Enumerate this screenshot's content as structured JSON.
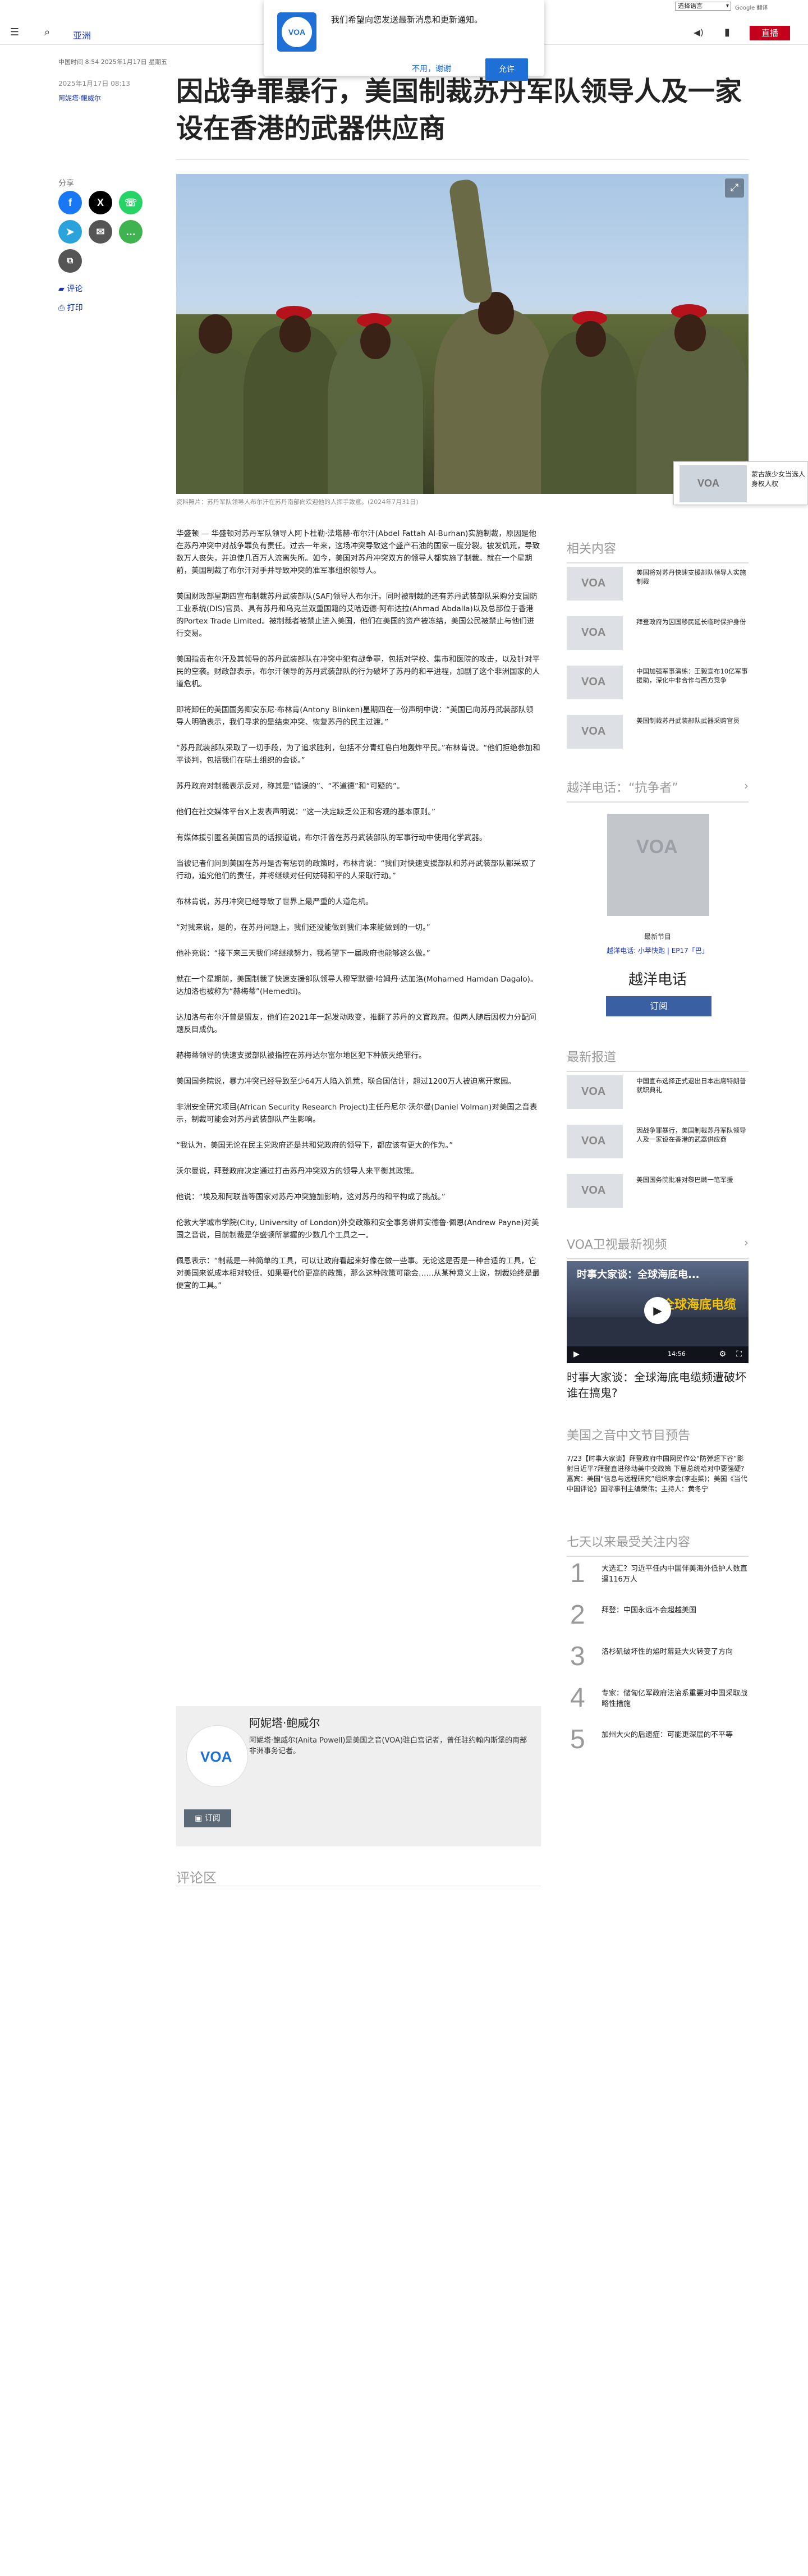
{
  "util": {
    "language": "选择语言",
    "powered": "Google 翻译"
  },
  "header": {
    "section": "亚洲",
    "live": "直播"
  },
  "popup": {
    "logo": "VOA",
    "message": "我们希望向您发送最新消息和更新通知。",
    "deny": "不用，谢谢",
    "allow": "允许"
  },
  "article": {
    "meta": "中国时间 8:54 2025年1月17日 星期五",
    "pubdate": "2025年1月17日 08:13",
    "author": "阿妮塔·鲍威尔",
    "title": "因战争罪暴行，美国制裁苏丹军队领导人及一家设在香港的武器供应商",
    "caption": "资料照片：苏丹军队领导人布尔汗在苏丹南部向欢迎他的人挥手致意。(2024年7月31日)",
    "paragraphs": [
      "华盛顿 — 华盛顿对苏丹军队领导人阿卜杜勒·法塔赫·布尔汗(Abdel Fattah Al-Burhan)实施制裁，原因是他在苏丹冲突中对战争罪负有责任。过去一年来，这场冲突导致这个盛产石油的国家一度分裂。被发饥荒，导致数万人丧失，并迫使几百万人流离失所。如今，美国对苏丹冲突双方的领导人都实施了制裁。就在一个星期前，美国制裁了布尔汗对手并导致冲突的准军事组织领导人。",
      "美国财政部星期四宣布制裁苏丹武装部队(SAF)领导人布尔汗。同时被制裁的还有苏丹武装部队采购分支国防工业系统(DIS)官员、具有苏丹和乌克兰双重国籍的艾哈迈德·阿布达拉(Ahmad Abdalla)以及总部位于香港的Portex Trade Limited。被制裁者被禁止进入美国，他们在美国的资产被冻结，美国公民被禁止与他们进行交易。",
      "美国指责布尔汗及其领导的苏丹武装部队在冲突中犯有战争罪，包括对学校、集市和医院的攻击，以及针对平民的空袭。财政部表示，布尔汗领导的苏丹武装部队的行为破坏了苏丹的和平进程，加剧了这个非洲国家的人道危机。",
      "即将卸任的美国国务卿安东尼·布林肯(Antony Blinken)星期四在一份声明中说：“美国已向苏丹武装部队领导人明确表示，我们寻求的是结束冲突、恢复苏丹的民主过渡。”",
      "“苏丹武装部队采取了一切手段，为了追求胜利，包括不分青红皂白地轰炸平民。”布林肯说。“他们拒绝参加和平谈判，包括我们在瑞士组织的会谈。”",
      "苏丹政府对制裁表示反对，称其是“错误的”、“不道德”和“可疑的”。",
      "他们在社交媒体平台X上发表声明说：“这一决定缺乏公正和客观的基本原则。”",
      "有媒体援引匿名美国官员的话报道说，布尔汗曾在苏丹武装部队的军事行动中使用化学武器。",
      "当被记者们问到美国在苏丹是否有惩罚的政策时，布林肯说：“我们对快速支援部队和苏丹武装部队都采取了行动，追究他们的责任，并将继续对任何妨碍和平的人采取行动。”",
      "布林肯说，苏丹冲突已经导致了世界上最严重的人道危机。",
      "“对我来说，是的，在苏丹问题上，我们还没能做到我们本来能做到的一切。”",
      "他补充说：“接下来三天我们将继续努力，我希望下一届政府也能够这么做。”",
      "就在一个星期前，美国制裁了快速支援部队领导人穆罕默德·哈姆丹·达加洛(Mohamed Hamdan Dagalo)。达加洛也被称为“赫梅蒂”(Hemedti)。",
      "达加洛与布尔汗曾是盟友，他们在2021年一起发动政变，推翻了苏丹的文官政府。但两人随后因权力分配问题反目成仇。",
      "赫梅蒂领导的快速支援部队被指控在苏丹达尔富尔地区犯下种族灭绝罪行。",
      "美国国务院说，暴力冲突已经导致至少64万人陷入饥荒，联合国估计，超过1200万人被迫离开家园。",
      "非洲安全研究项目(African Security Research Project)主任丹尼尔·沃尔曼(Daniel Volman)对美国之音表示，制裁可能会对苏丹武装部队产生影响。",
      "“我认为，美国无论在民主党政府还是共和党政府的领导下，都应该有更大的作为。”",
      "沃尔曼说，拜登政府决定通过打击苏丹冲突双方的领导人来平衡其政策。",
      "他说：“埃及和阿联酋等国家对苏丹冲突施加影响，这对苏丹的和平构成了挑战。”",
      "伦敦大学城市学院(City, University of London)外交政策和安全事务讲师安德鲁·佩恩(Andrew Payne)对美国之音说，目前制裁是华盛顿所掌握的少数几个工具之一。",
      "佩恩表示：“制裁是一种简单的工具，可以让政府看起来好像在做一些事。无论这是否是一种合适的工具，它对美国来说成本相对较低。如果要代价更高的政策，那么这种政策可能会……从某种意义上说，制裁始终是最便宜的工具。”"
    ]
  },
  "share": {
    "label": "分享",
    "comment": "评论",
    "print": "打印"
  },
  "promo": {
    "logo": "VOA",
    "text": "蒙古族少女当选人身权人权"
  },
  "authorbox": {
    "name": "阿妮塔·鲍威尔",
    "logo": "VOA",
    "bio": "阿妮塔·鲍威尔(Anita Powell)是美国之音(VOA)驻白宫记者，曾任驻约翰内斯堡的南部非洲事务记者。",
    "subscribe": "订阅"
  },
  "comments": "评论区",
  "rail": {
    "related_title": "相关内容",
    "related": [
      "美国将对苏丹快速支援部队领导人实施制裁",
      "拜登政府为因国移民延长临时保护身份",
      "中国加强军事演练：王毅宣布10亿军事援助，深化中非合作与西方竞争",
      "美国制裁苏丹武装部队武器采购官员"
    ],
    "podcast_title": "越洋电话：“抗争者”",
    "podcast_logo": "VOA",
    "podcast_small": "最新节目",
    "podcast_links": "越洋电话: 小苹快跑 | EP17「巴」",
    "podcast_name": "越洋电话",
    "podcast_subscribe": "订阅",
    "latest_title": "最新报道",
    "latest": [
      "中国宣布选择正式退出日本出席特朗普就职典礼",
      "因战争罪暴行，美国制裁苏丹军队领导人及一家设在香港的武器供应商",
      "美国国务院批准对黎巴嫩一笔军援"
    ],
    "video_section": "VOA卫视最新视频",
    "video_overlay_1": "时事大家谈：全球海底电...",
    "video_overlay_2": "全球海底电缆",
    "video_time": "14:56",
    "video_caption": "时事大家谈：全球海底电缆频遭破坏 谁在搞鬼?",
    "listen_title": "美国之音中文节目预告",
    "listen_text": "7/23【时事大家谈】拜登政府中国网民作公“防弹超下谷”影射日近平?拜登直进移动美中交政策 下届总统哈对中要强硬? 嘉宾：美国“信息与远程研究”组织李金(李韭菜)；美国《当代中国评论》国际事刊主编荣伟；主持人：黄冬宁",
    "popular_title": "七天以来最受关注内容",
    "popular": [
      "大选汇？习近平任内中国伴美海外低护人数直逼116万人",
      "拜登：中国永远不会超越美国",
      "洛杉矶破坏性的焰时幕延大火转变了方向",
      "专家：储匈亿军政府法治系重要对中国采取战略性措施",
      "加州大火的后遗症：可能更深层的不平等"
    ]
  }
}
